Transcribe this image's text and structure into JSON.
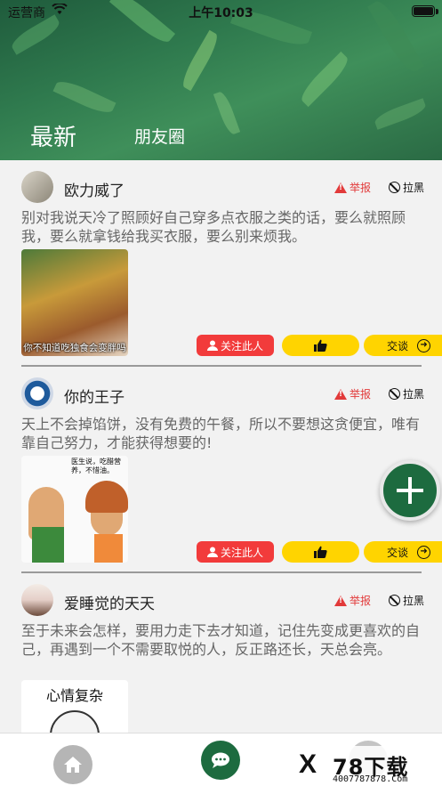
{
  "status_bar": {
    "carrier": "运营商",
    "time": "上午10:03"
  },
  "header_tabs": {
    "latest": "最新",
    "friends": "朋友圈"
  },
  "post_actions": {
    "report": "举报",
    "block": "拉黑",
    "follow": "关注此人",
    "chat": "交谈"
  },
  "posts": [
    {
      "username": "欧力威了",
      "content": "别对我说天冷了照顾好自己穿多点衣服之类的话，要么就照顾我，要么就拿钱给我买衣服，要么别来烦我。",
      "image_caption": "你不知道吃独食会变胖吗"
    },
    {
      "username": "你的王子",
      "content": "天上不会掉馅饼，没有免费的午餐，所以不要想这贪便宜，唯有靠自己努力，才能获得想要的!",
      "image_caption": "医生说，吃醋营养，不惜油。"
    },
    {
      "username": "爱睡觉的天天",
      "content": "至于未来会怎样，要用力走下去才知道，记住先变成更喜欢的自己，再遇到一个不需要取悦的人，反正路还长，天总会亮。",
      "image_caption": "心情复杂"
    }
  ],
  "fab": {
    "icon": "plus-icon"
  },
  "tab_bar": {
    "items": [
      "home-icon",
      "chat-bubble-icon",
      "profile-icon"
    ]
  },
  "watermark": {
    "logo": "X",
    "big": "78下载",
    "small": "4007787878.Com"
  },
  "colors": {
    "primary_green": "#1d6b3f",
    "report_red": "#e23a3a",
    "follow_red": "#f23b3b",
    "yellow": "#ffd400"
  }
}
